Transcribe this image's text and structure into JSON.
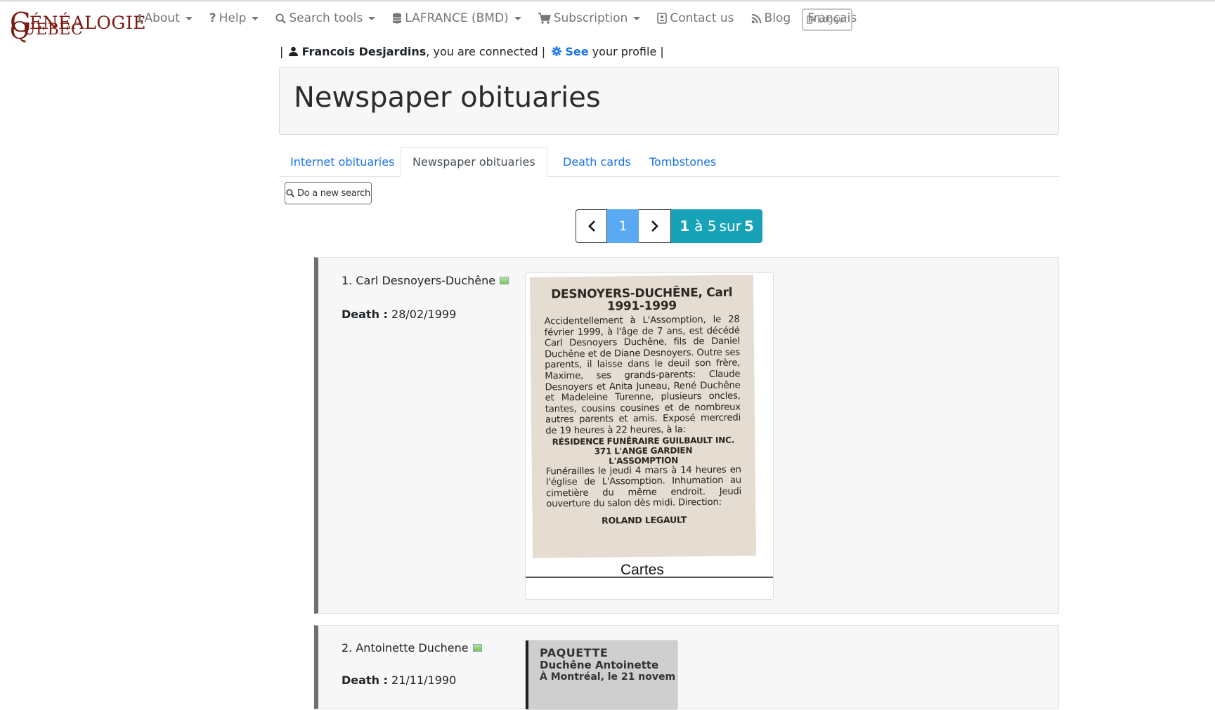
{
  "logo": {
    "line1_initial": "G",
    "line1_rest": "ÉNÉALOGIE",
    "line2_initial": "Q",
    "line2_rest": "UEBEC"
  },
  "nav": {
    "items": [
      {
        "icon": "info-icon",
        "label": "About",
        "dropdown": true
      },
      {
        "icon": "question-icon",
        "label": "Help",
        "dropdown": true
      },
      {
        "icon": "search-icon",
        "label": "Search tools",
        "dropdown": true
      },
      {
        "icon": "database-icon",
        "label": "LAFRANCE (BMD)",
        "dropdown": true
      },
      {
        "icon": "cart-icon",
        "label": "Subscription",
        "dropdown": true
      },
      {
        "icon": "contact-icon",
        "label": "Contact us",
        "dropdown": false
      },
      {
        "icon": "rss-icon",
        "label": "Blog",
        "dropdown": false
      },
      {
        "icon": "",
        "label": "Français",
        "dropdown": false
      }
    ],
    "logout_label": "Logout"
  },
  "user": {
    "pipe": "|",
    "name": "Francois Desjardins",
    "connected_text": ", you are connected |",
    "see_link": "See",
    "profile_text": "your profile |"
  },
  "page_title": "Newspaper obituaries",
  "tabs": [
    {
      "label": "Internet obituaries",
      "active": false
    },
    {
      "label": "Newspaper obituaries",
      "active": true
    },
    {
      "label": "Death cards",
      "active": false
    },
    {
      "label": "Tombstones",
      "active": false
    }
  ],
  "new_search_label": "Do a new search",
  "pagination": {
    "prev": "‹",
    "current": "1",
    "next": "›",
    "range_start": "1",
    "range_mid": "à 5",
    "range_sur": "sur",
    "range_total": "5"
  },
  "results": [
    {
      "index_name": "1. Carl Desnoyers-Duchêne",
      "death_label": "Death :",
      "death_date": "28/02/1999",
      "clipping": {
        "heading": "DESNOYERS-DUCHÊNE, Carl",
        "years": "1991-1999",
        "body": "Accidentellement à L'Assomption, le 28 février 1999, à l'âge de 7 ans, est décédé Carl Desnoyers Duchêne, fils de Daniel Duchêne et de Diane Desnoyers. Outre ses parents, il laisse dans le deuil son frère, Maxime, ses grands-parents: Claude Desnoyers et Anita Juneau, René Duchêne et Madeleine Turenne, plusieurs oncles, tantes, cousins cousines et de nombreux autres parents et amis. Exposé mercredi de 19 heures à 22 heures, à la:",
        "home1": "RÉSIDENCE FUNÉRAIRE GUILBAULT INC.",
        "home2": "371 L'ANGE GARDIEN",
        "home3": "L'ASSOMPTION",
        "body2": "Funérailles le jeudi 4 mars à 14 heures en l'église de L'Assomption. Inhumation au cimetière du même endroit. Jeudi ouverture du salon dès midi. Direction:",
        "signature": "ROLAND LEGAULT",
        "footer": "Cartes"
      }
    },
    {
      "index_name": "2. Antoinette Duchene",
      "death_label": "Death :",
      "death_date": "21/11/1990",
      "clipping": {
        "heading": "PAQUETTE",
        "sub": "Duchêne Antoinette",
        "line": "À Montréal, le 21 novem"
      }
    }
  ],
  "colors": {
    "logo": "#7a1b12",
    "link": "#1a73e8",
    "pager_current": "#5aa9f3",
    "pager_range": "#17a2b8"
  }
}
